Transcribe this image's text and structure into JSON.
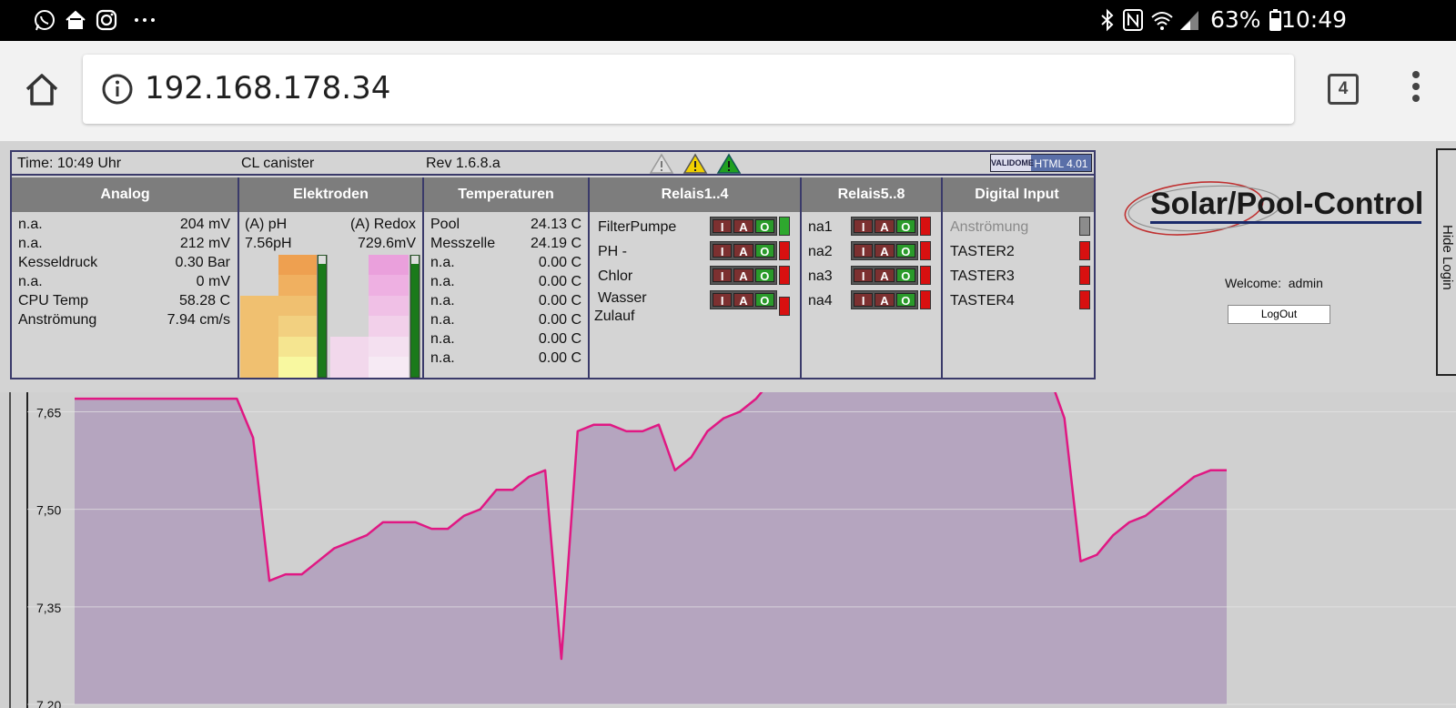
{
  "status_bar": {
    "left_icons": [
      "whatsapp-icon",
      "home-app-icon",
      "instagram-icon",
      "more-icon"
    ],
    "right_icons": [
      "bluetooth-icon",
      "nfc-icon",
      "wifi-icon",
      "signal-icon",
      "battery-icon"
    ],
    "battery_percent": "63%",
    "time": "10:49"
  },
  "browser": {
    "url": "192.168.178.34",
    "tab_count": "4"
  },
  "panel": {
    "time": "Time: 10:49 Uhr",
    "product": "CL canister",
    "revision": "Rev 1.6.8.a",
    "warning_colors": [
      "#c8c8c8",
      "#f0d000",
      "#20a020"
    ],
    "badge_left": "VALIDOME",
    "badge_right": "HTML 4.01",
    "headers": [
      "Analog",
      "Elektroden",
      "Temperaturen",
      "Relais1..4",
      "Relais5..8",
      "Digital Input"
    ],
    "analog": [
      {
        "label": "n.a.",
        "value": "204 mV"
      },
      {
        "label": "n.a.",
        "value": "212 mV"
      },
      {
        "label": "Kesseldruck",
        "value": "0.30 Bar"
      },
      {
        "label": "n.a.",
        "value": "0 mV"
      },
      {
        "label": "CPU Temp",
        "value": "58.28 C"
      },
      {
        "label": "Anströmung",
        "value": "7.94 cm/s"
      }
    ],
    "electrodes": {
      "ph_label": "(A) pH",
      "ph_value": "7.56pH",
      "redox_label": "(A) Redox",
      "redox_value": "729.6mV"
    },
    "temperatures": [
      {
        "label": "Pool",
        "value": "24.13 C"
      },
      {
        "label": "Messzelle",
        "value": "24.19 C"
      },
      {
        "label": "n.a.",
        "value": "0.00 C"
      },
      {
        "label": "n.a.",
        "value": "0.00 C"
      },
      {
        "label": "n.a.",
        "value": "0.00 C"
      },
      {
        "label": "n.a.",
        "value": "0.00 C"
      },
      {
        "label": "n.a.",
        "value": "0.00 C"
      },
      {
        "label": "n.a.",
        "value": "0.00 C"
      }
    ],
    "iao_labels": [
      "I",
      "A",
      "O"
    ],
    "relais_1_4": [
      {
        "label": "FilterPumpe",
        "state": "green"
      },
      {
        "label": "PH -",
        "state": "red"
      },
      {
        "label": "Chlor",
        "state": "red"
      },
      {
        "label": "Wasser",
        "label2": "Zulauf",
        "state": "red"
      }
    ],
    "relais_5_8": [
      {
        "label": "na1",
        "state": "red"
      },
      {
        "label": "na2",
        "state": "red"
      },
      {
        "label": "na3",
        "state": "red"
      },
      {
        "label": "na4",
        "state": "red"
      }
    ],
    "digital_inputs": [
      {
        "label": "Anströmung",
        "state": "grey",
        "disabled": true
      },
      {
        "label": "TASTER2",
        "state": "red"
      },
      {
        "label": "TASTER3",
        "state": "red"
      },
      {
        "label": "TASTER4",
        "state": "red"
      }
    ]
  },
  "logo_text": "Solar/Pool-Control",
  "welcome_label": "Welcome:",
  "welcome_user": "admin",
  "logout_label": "LogOut",
  "hide_login_label": "Hide Login",
  "chart_data": {
    "type": "area",
    "yticks": [
      "7,65",
      "7,50",
      "7,35",
      "7,20"
    ],
    "ylim": [
      7.2,
      7.68
    ],
    "fill_color": "#b5a5bf",
    "line_color": "#e01883",
    "values": [
      7.67,
      7.67,
      7.67,
      7.67,
      7.67,
      7.67,
      7.67,
      7.67,
      7.67,
      7.67,
      7.67,
      7.61,
      7.39,
      7.4,
      7.4,
      7.42,
      7.44,
      7.45,
      7.46,
      7.48,
      7.48,
      7.48,
      7.47,
      7.47,
      7.49,
      7.5,
      7.53,
      7.53,
      7.55,
      7.56,
      7.27,
      7.62,
      7.63,
      7.63,
      7.62,
      7.62,
      7.63,
      7.56,
      7.58,
      7.62,
      7.64,
      7.65,
      7.67,
      7.7,
      7.71,
      7.71,
      7.71,
      7.71,
      7.71,
      7.72,
      7.72,
      7.71,
      7.71,
      7.71,
      7.71,
      7.71,
      7.71,
      7.71,
      7.71,
      7.71,
      7.71,
      7.64,
      7.42,
      7.43,
      7.46,
      7.48,
      7.49,
      7.51,
      7.53,
      7.55,
      7.56,
      7.56
    ]
  }
}
